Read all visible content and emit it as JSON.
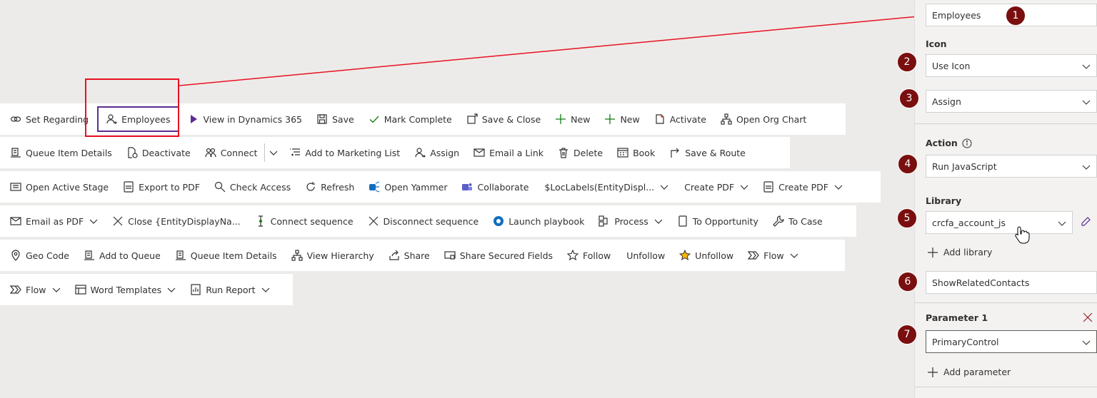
{
  "ribbon": {
    "row1": [
      "Set Regarding",
      "Employees",
      "View in Dynamics 365",
      "Save",
      "Mark Complete",
      "Save & Close",
      "New",
      "New",
      "Activate",
      "Open Org Chart"
    ],
    "row2": [
      "Queue Item Details",
      "Deactivate",
      "Connect",
      "Add to Marketing List",
      "Assign",
      "Email a Link",
      "Delete",
      "Book",
      "Save & Route"
    ],
    "row3": [
      "Open Active Stage",
      "Export to PDF",
      "Check Access",
      "Refresh",
      "Open Yammer",
      "Collaborate",
      "$LocLabels(EntityDispl...",
      "Create PDF",
      "Create PDF"
    ],
    "row4": [
      "Email as PDF",
      "Close {EntityDisplayNa...",
      "Connect sequence",
      "Disconnect sequence",
      "Launch playbook",
      "Process",
      "To Opportunity",
      "To Case"
    ],
    "row5": [
      "Geo Code",
      "Add to Queue",
      "Queue Item Details",
      "View Hierarchy",
      "Share",
      "Share Secured Fields",
      "Follow",
      "Unfollow",
      "Unfollow",
      "Flow"
    ],
    "row6": [
      "Flow",
      "Word Templates",
      "Run Report"
    ]
  },
  "panel": {
    "label_value": "Employees",
    "icon_label": "Icon",
    "icon_mode": "Use Icon",
    "icon_value": "Assign",
    "action_label": "Action",
    "action_value": "Run JavaScript",
    "library_label": "Library",
    "library_value": "crcfa_account_js",
    "add_library": "Add library",
    "function_value": "ShowRelatedContacts",
    "param1_label": "Parameter 1",
    "param1_value": "PrimaryControl",
    "add_parameter": "Add parameter"
  },
  "badges": [
    "1",
    "2",
    "3",
    "4",
    "5",
    "6",
    "7"
  ],
  "colors": {
    "accent": "#5c2e91",
    "badge": "#7a0f0f",
    "annotation": "#e81123",
    "green_plus": "#107c10"
  }
}
